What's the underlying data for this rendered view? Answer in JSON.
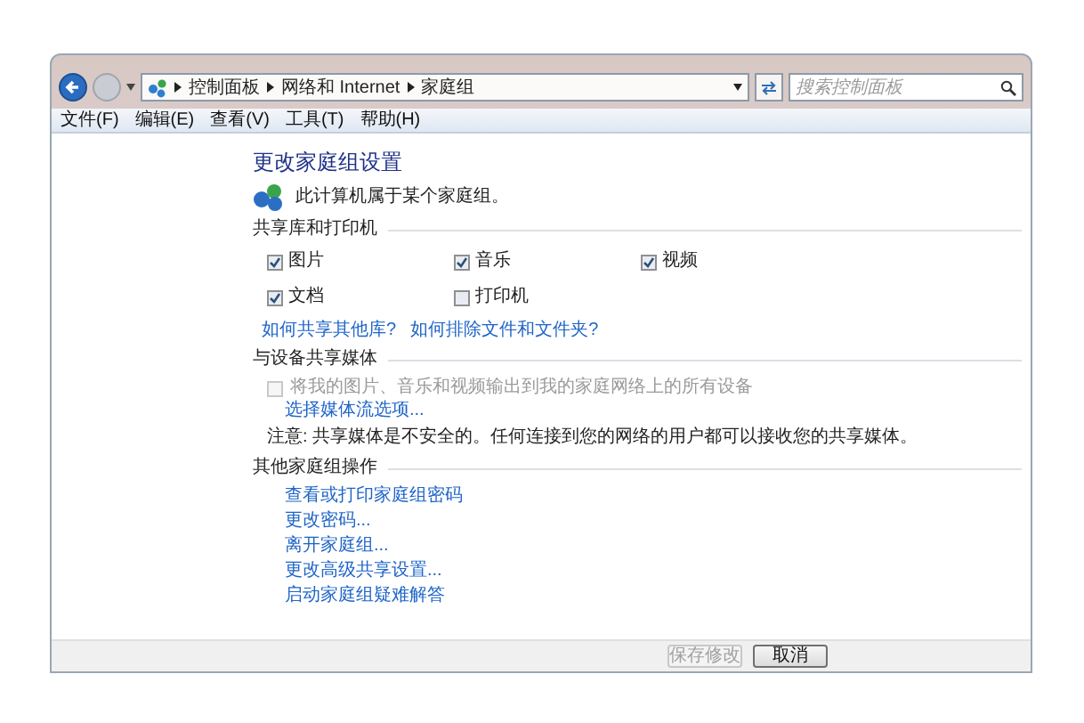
{
  "address_bar": {
    "crumbs": [
      "控制面板",
      "网络和 Internet",
      "家庭组"
    ]
  },
  "search": {
    "placeholder": "搜索控制面板"
  },
  "menu": [
    "文件(F)",
    "编辑(E)",
    "查看(V)",
    "工具(T)",
    "帮助(H)"
  ],
  "page_title": "更改家庭组设置",
  "status_text": "此计算机属于某个家庭组。",
  "sections": [
    {
      "title": "共享库和打印机",
      "items": [
        {
          "kind": "check",
          "label": "图片",
          "checked": true,
          "disabled": false
        },
        {
          "kind": "check",
          "label": "音乐",
          "checked": true,
          "disabled": false
        },
        {
          "kind": "check",
          "label": "视频",
          "checked": true,
          "disabled": false
        },
        {
          "kind": "check",
          "label": "文档",
          "checked": true,
          "disabled": false
        },
        {
          "kind": "check",
          "label": "打印机",
          "checked": false,
          "disabled": false
        }
      ],
      "links": [
        "如何共享其他库?",
        "如何排除文件和文件夹?"
      ]
    },
    {
      "title": "与设备共享媒体",
      "media_option": {
        "label": "将我的图片、音乐和视频输出到我的家庭网络上的所有设备",
        "checked": false,
        "disabled": true
      },
      "links": [
        "选择媒体流选项..."
      ],
      "note": "注意: 共享媒体是不安全的。任何连接到您的网络的用户都可以接收您的共享媒体。"
    },
    {
      "title": "其他家庭组操作",
      "links": [
        "查看或打印家庭组密码",
        "更改密码...",
        "离开家庭组...",
        "更改高级共享设置...",
        "启动家庭组疑难解答"
      ]
    }
  ],
  "buttons": [
    {
      "label": "保存修改",
      "disabled": true
    },
    {
      "label": "取消",
      "disabled": false
    }
  ]
}
